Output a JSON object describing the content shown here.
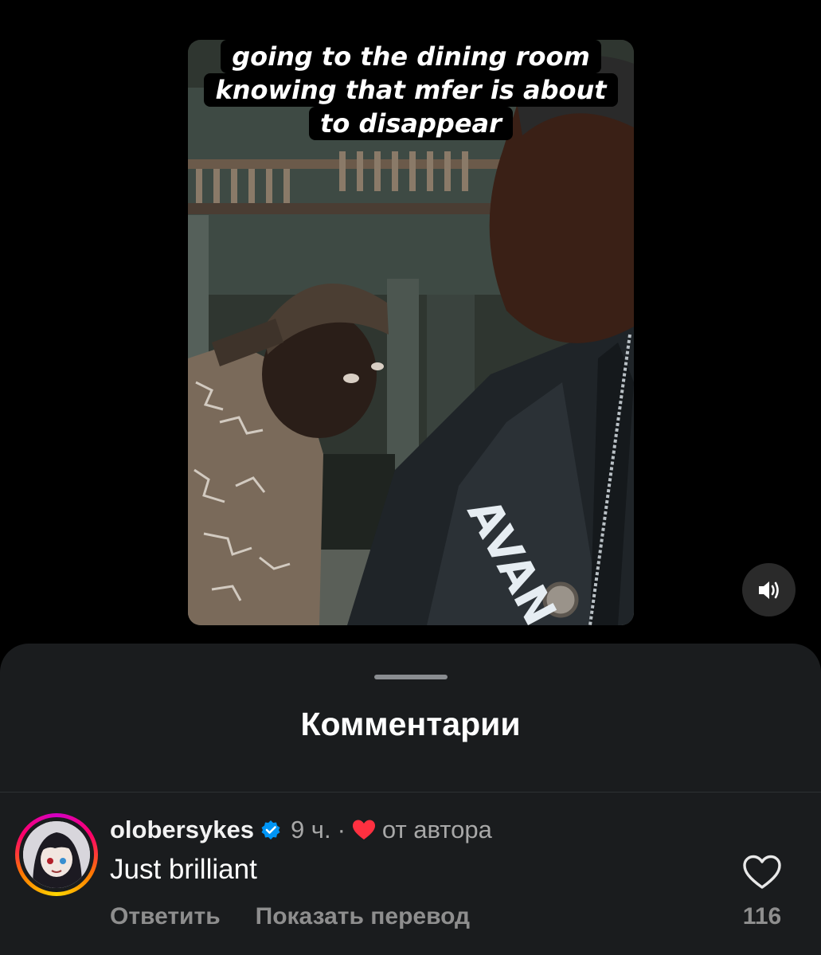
{
  "video": {
    "caption_lines": [
      "going to the dining room",
      "knowing that mfer is about",
      "to disappear"
    ],
    "shirt_text": "AVAN",
    "sound_icon": "speaker-on-icon"
  },
  "comments_sheet": {
    "title": "Комментарии",
    "comment": {
      "username": "olobersykes",
      "verified_icon": "verified-badge-icon",
      "time": "9 ч.",
      "separator": "·",
      "liked_by_author_icon": "heart-filled-icon",
      "by_author_label": "от автора",
      "text": "Just brilliant",
      "reply_label": "Ответить",
      "translate_label": "Показать перевод",
      "like_icon": "heart-outline-icon",
      "like_count": "116"
    },
    "colors": {
      "sheet_bg": "#1a1c1e",
      "secondary_text": "#a8a8a8",
      "verified_blue": "#0095f6",
      "heart_red": "#ff3040"
    }
  }
}
